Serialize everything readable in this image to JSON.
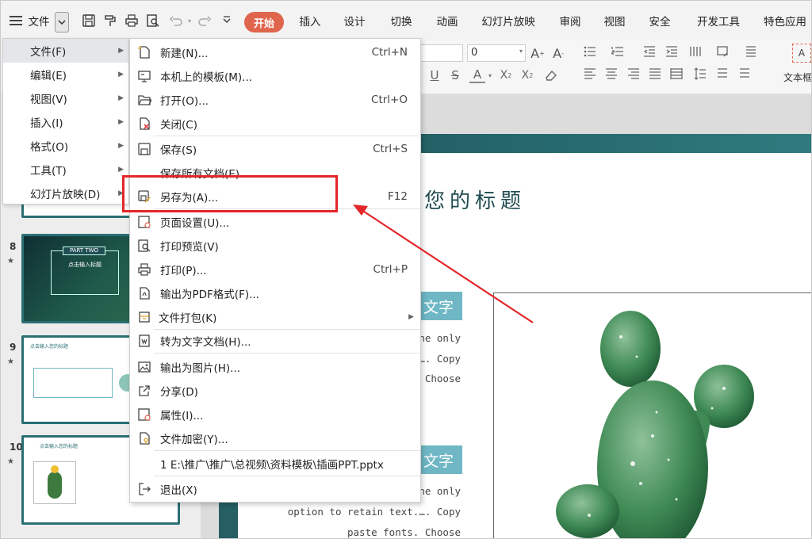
{
  "topbar": {
    "file_label": "文件",
    "tabs": [
      "开始",
      "插入",
      "设计",
      "切换",
      "动画",
      "幻灯片放映",
      "审阅",
      "视图",
      "安全",
      "开发工具",
      "特色应用"
    ],
    "icons": [
      "hamburger-icon",
      "save-icon",
      "format-painter-icon",
      "print-icon",
      "print-preview-icon",
      "undo-icon",
      "redo-icon",
      "more-icon"
    ],
    "accent_color": "#e0654d"
  },
  "ribbon": {
    "font_size_value": "0",
    "text_box_label": "文本框"
  },
  "menu_level1": {
    "items": [
      {
        "label": "文件(F)"
      },
      {
        "label": "编辑(E)"
      },
      {
        "label": "视图(V)"
      },
      {
        "label": "插入(I)"
      },
      {
        "label": "格式(O)"
      },
      {
        "label": "工具(T)"
      },
      {
        "label": "幻灯片放映(D)"
      }
    ]
  },
  "menu_level2": {
    "items": [
      {
        "label": "新建(N)...",
        "shortcut": "Ctrl+N",
        "icon": "new-file-icon"
      },
      {
        "label": "本机上的模板(M)...",
        "shortcut": "",
        "icon": "template-icon"
      },
      {
        "label": "打开(O)...",
        "shortcut": "Ctrl+O",
        "icon": "open-folder-icon"
      },
      {
        "label": "关闭(C)",
        "shortcut": "",
        "icon": "close-file-icon"
      },
      {
        "label": "保存(S)",
        "shortcut": "Ctrl+S",
        "icon": "save-icon"
      },
      {
        "label": "保存所有文档(E)",
        "shortcut": "",
        "icon": ""
      },
      {
        "label": "另存为(A)...",
        "shortcut": "F12",
        "icon": "save-as-icon"
      },
      {
        "label": "页面设置(U)...",
        "shortcut": "",
        "icon": "page-setup-icon"
      },
      {
        "label": "打印预览(V)",
        "shortcut": "",
        "icon": "print-preview-icon"
      },
      {
        "label": "打印(P)...",
        "shortcut": "Ctrl+P",
        "icon": "print-icon"
      },
      {
        "label": "输出为PDF格式(F)...",
        "shortcut": "",
        "icon": "pdf-export-icon"
      },
      {
        "label": "文件打包(K)",
        "shortcut": "",
        "icon": "package-icon"
      },
      {
        "label": "转为文字文档(H)...",
        "shortcut": "",
        "icon": "convert-doc-icon"
      },
      {
        "label": "输出为图片(H)...",
        "shortcut": "",
        "icon": "export-image-icon"
      },
      {
        "label": "分享(D)",
        "shortcut": "",
        "icon": "share-icon"
      },
      {
        "label": "属性(I)...",
        "shortcut": "",
        "icon": "properties-icon"
      },
      {
        "label": "文件加密(Y)...",
        "shortcut": "",
        "icon": "encrypt-icon"
      },
      {
        "label": "1 E:\\推广\\推广\\总视频\\资料模板\\插画PPT.pptx",
        "shortcut": "",
        "icon": ""
      },
      {
        "label": "退出(X)",
        "shortcut": "",
        "icon": "exit-icon"
      }
    ]
  },
  "sidebar": {
    "slides": [
      {
        "num": "8",
        "star": "★",
        "title": "PART TWO",
        "subtitle": "点击输入标题"
      },
      {
        "num": "9",
        "star": "★",
        "title": "点击输入您的标题"
      },
      {
        "num": "10",
        "star": "★",
        "title": "点击输入您的标题"
      }
    ]
  },
  "slide": {
    "title_fragment": "您的标题",
    "section_label_1": "文字",
    "section_label_2": "文字",
    "body1": [
      "he only",
      "…. Copy",
      "Choose"
    ],
    "body2": [
      "he only",
      "option to retain text.…. Copy",
      "paste fonts. Choose"
    ],
    "theme_color": "#2a6f74",
    "section_color": "#6fb7c5"
  },
  "annotation": {
    "highlight_color": "#e3262a"
  }
}
